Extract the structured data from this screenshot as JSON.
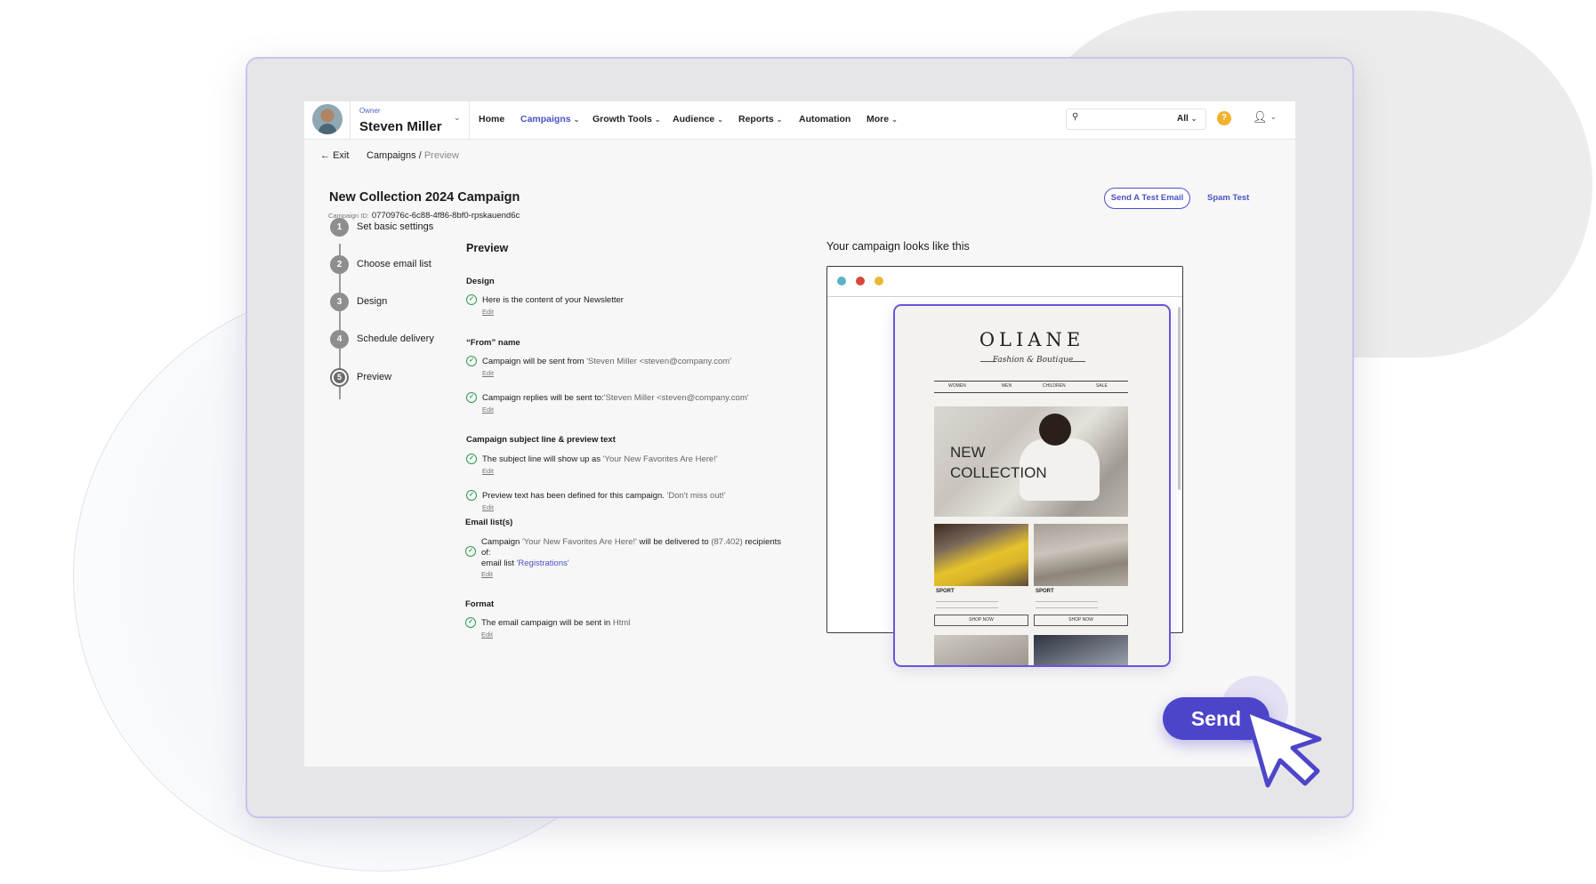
{
  "header": {
    "owner_label": "Owner",
    "owner_name": "Steven Miller",
    "nav": [
      {
        "label": "Home",
        "dropdown": false,
        "active": false
      },
      {
        "label": "Campaigns",
        "dropdown": true,
        "active": true
      },
      {
        "label": "Growth Tools",
        "dropdown": true,
        "active": false
      },
      {
        "label": "Audience",
        "dropdown": true,
        "active": false
      },
      {
        "label": "Reports",
        "dropdown": true,
        "active": false
      },
      {
        "label": "Automation",
        "dropdown": false,
        "active": false
      },
      {
        "label": "More",
        "dropdown": true,
        "active": false
      }
    ],
    "search_filter": "All"
  },
  "breadcrumb": {
    "exit_label": "Exit",
    "parent": "Campaigns",
    "separator": "/",
    "current": "Preview"
  },
  "campaign": {
    "title": "New Collection 2024 Campaign",
    "id_label": "Campaign ID:",
    "id_value": "0770976c-6c88-4f86-8bf0-rpskauend6c",
    "send_test_label": "Send A Test Email",
    "spam_test_label": "Spam Test"
  },
  "steps": [
    {
      "num": "1",
      "label": "Set basic settings"
    },
    {
      "num": "2",
      "label": "Choose email list"
    },
    {
      "num": "3",
      "label": "Design"
    },
    {
      "num": "4",
      "label": "Schedule delivery"
    },
    {
      "num": "5",
      "label": "Preview",
      "current": true
    }
  ],
  "preview": {
    "title": "Preview",
    "edit_label": "Edit",
    "design": {
      "heading": "Design",
      "item": "Here is the content of your Newsletter"
    },
    "from_name": {
      "heading": "“From” name",
      "sent_from_text": "Campaign will be sent from",
      "sent_from_value": "'Steven Miller <steven@company.com'",
      "replies_text": "Campaign replies will be sent to:",
      "replies_value": "'Steven Miller <steven@company.com'"
    },
    "subject": {
      "heading": "Campaign subject line & preview text",
      "subject_text": "The subject line will show up as",
      "subject_value": "'Your New Favorites Are Here!'",
      "preview_text": "Preview text has been defined for this campaign.",
      "preview_value": "'Don't miss out!'"
    },
    "email_lists": {
      "heading": "Email list(s)",
      "campaign_label": "Campaign",
      "campaign_value": "'Your New Favorites Are Here!'",
      "delivered_text": "will be delivered to",
      "recipients_count": "(87.402)",
      "recipients_label": "recipients",
      "of_label": "of:",
      "list_label": "email list",
      "list_value": "'Registrations'"
    },
    "format": {
      "heading": "Format",
      "text": "The email campaign will be sent in",
      "value": "Html"
    }
  },
  "email_preview": {
    "heading": "Your campaign looks like this",
    "window_dot_colors": [
      "#5ab3c6",
      "#d9483f",
      "#e8b836"
    ],
    "brand": "OLIANE",
    "brand_tagline": "Fashion & Boutique",
    "menu": [
      "WOMEN",
      "MEN",
      "CHILDREN",
      "SALE"
    ],
    "hero_line1": "NEW",
    "hero_line2": "COLLECTION",
    "tile1_label": "SPORT",
    "tile2_label": "SPORT",
    "shop_now": "SHOP NOW"
  },
  "send_label": "Send",
  "colors": {
    "accent": "#4a51c7",
    "send_button": "#4d45c9",
    "check_green": "#2f9a52",
    "help_icon": "#f1b12c"
  }
}
